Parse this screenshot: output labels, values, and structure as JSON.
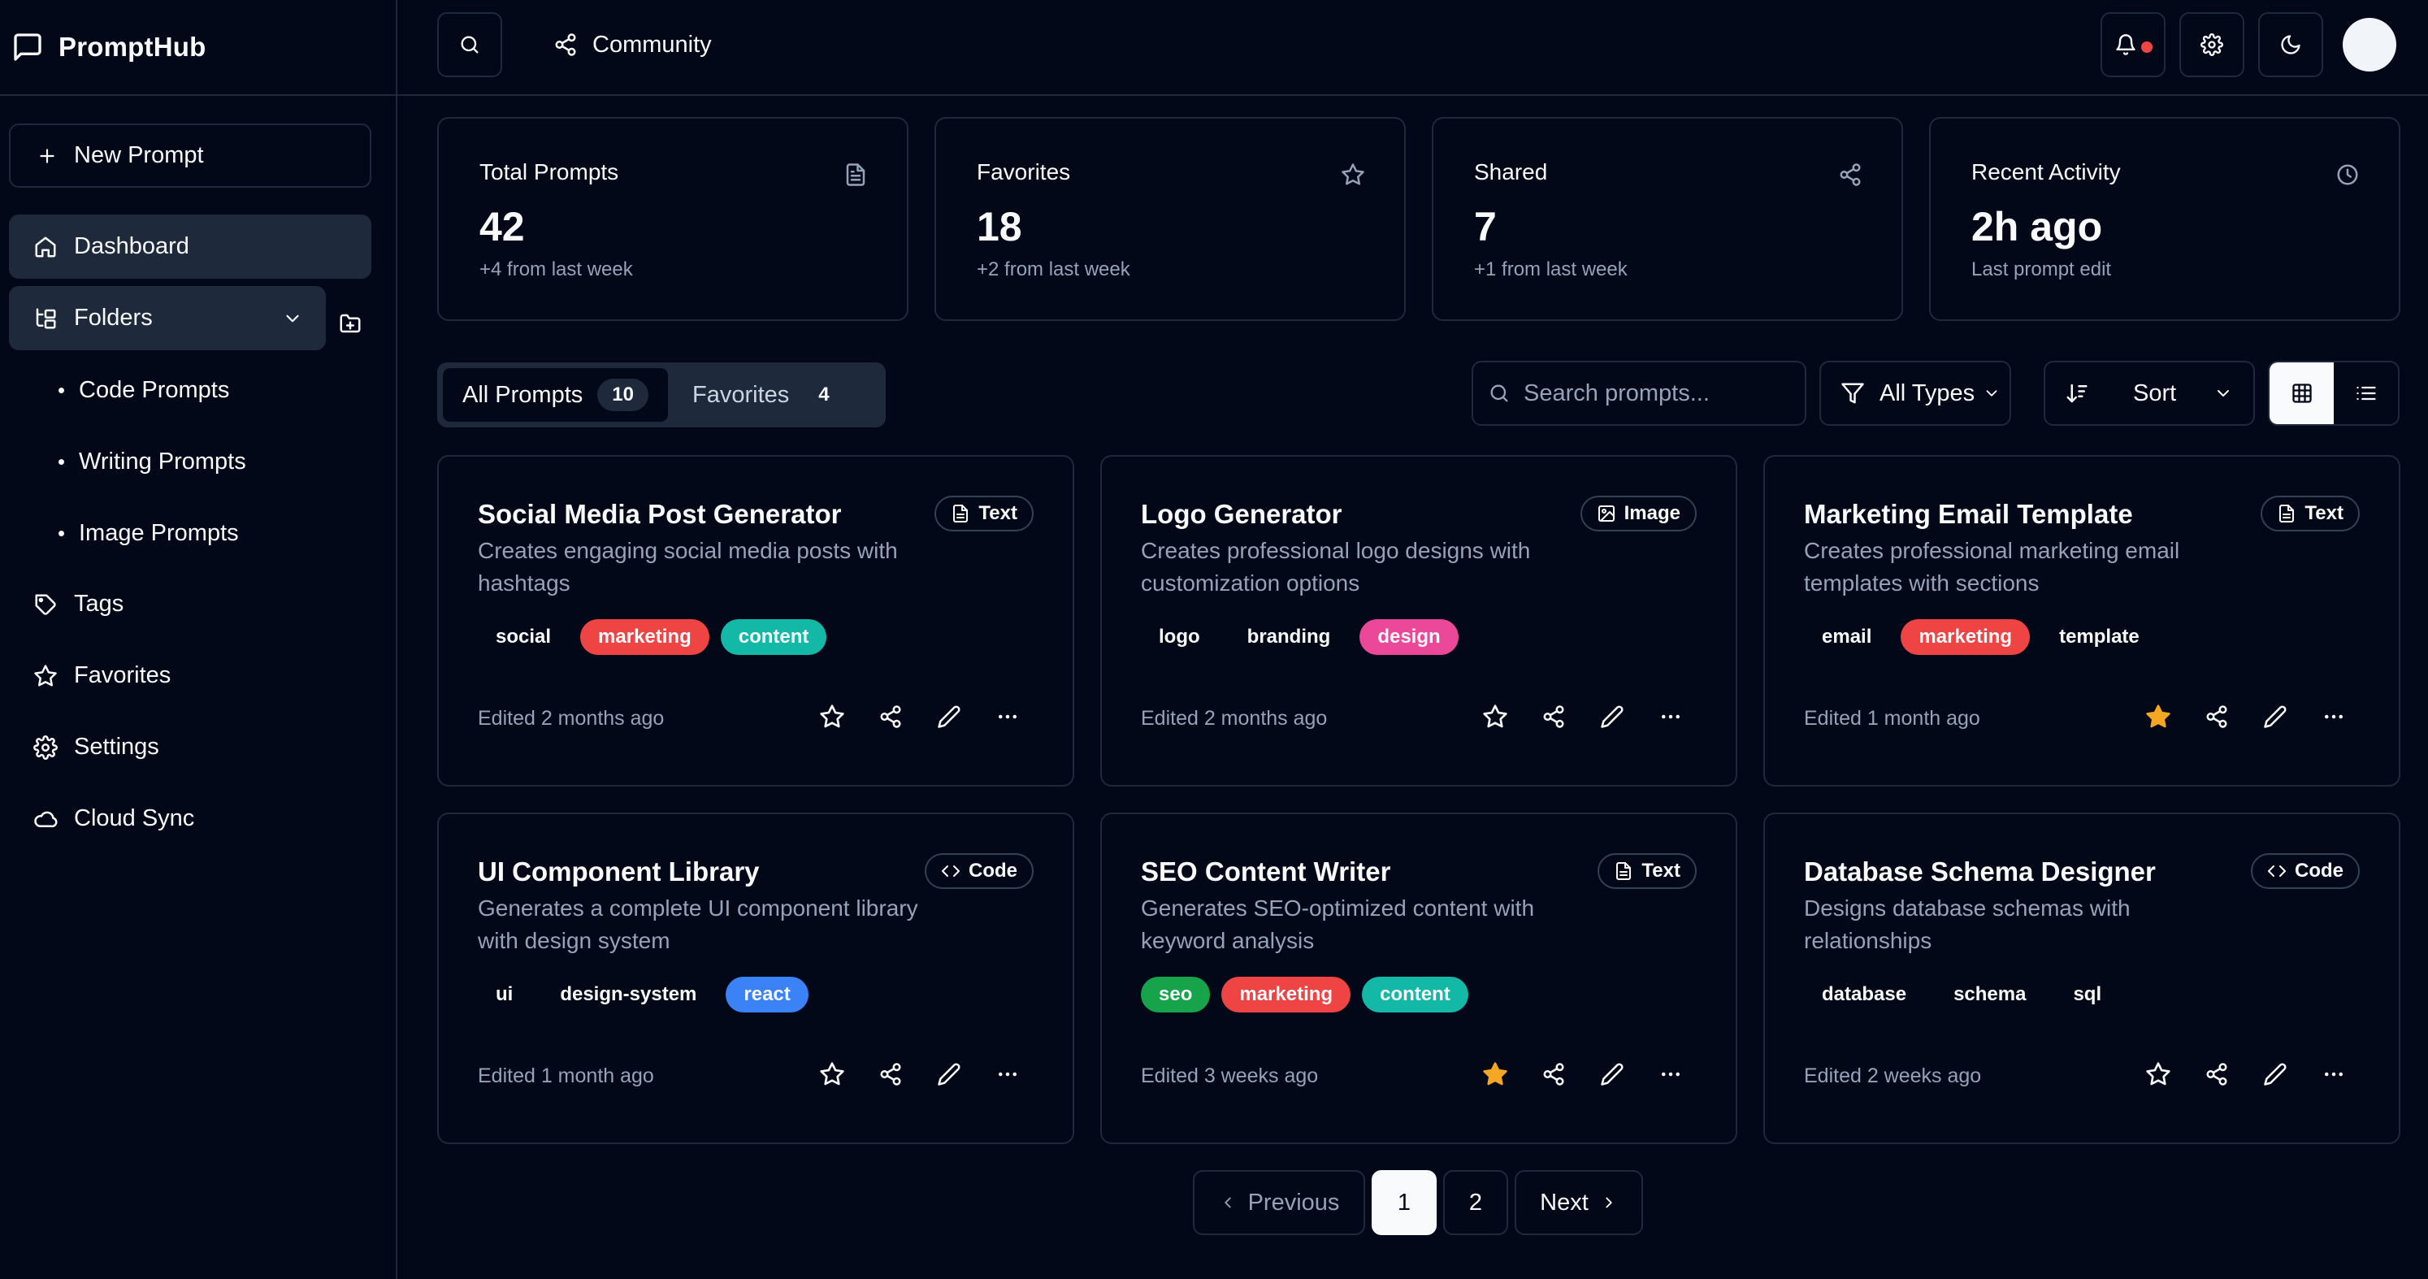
{
  "app": {
    "name": "PromptHub"
  },
  "sidebar": {
    "new_prompt": "New Prompt",
    "items": [
      {
        "label": "Dashboard"
      },
      {
        "label": "Folders"
      },
      {
        "label": "Tags"
      },
      {
        "label": "Favorites"
      },
      {
        "label": "Settings"
      },
      {
        "label": "Cloud Sync"
      }
    ],
    "folders": [
      {
        "label": "Code Prompts"
      },
      {
        "label": "Writing Prompts"
      },
      {
        "label": "Image Prompts"
      }
    ]
  },
  "topbar": {
    "community": "Community",
    "notification_dot_color": "#ef4444"
  },
  "stats": [
    {
      "label": "Total Prompts",
      "value": "42",
      "sub": "+4 from last week",
      "icon": "file-text-icon"
    },
    {
      "label": "Favorites",
      "value": "18",
      "sub": "+2 from last week",
      "icon": "star-icon"
    },
    {
      "label": "Shared",
      "value": "7",
      "sub": "+1 from last week",
      "icon": "share-icon"
    },
    {
      "label": "Recent Activity",
      "value": "2h ago",
      "sub": "Last prompt edit",
      "icon": "clock-icon"
    }
  ],
  "tabs": [
    {
      "label": "All Prompts",
      "count": "10"
    },
    {
      "label": "Favorites",
      "count": "4"
    }
  ],
  "search": {
    "placeholder": "Search prompts..."
  },
  "filters": {
    "type": "All Types",
    "sort": "Sort"
  },
  "cards": [
    {
      "title": "Social Media Post Generator",
      "description": "Creates engaging social media posts with hashtags",
      "type": "Text",
      "type_icon": "file-text-icon",
      "tags": [
        {
          "label": "social",
          "color": ""
        },
        {
          "label": "marketing",
          "color": "#ef4444"
        },
        {
          "label": "content",
          "color": "#14b8a6"
        }
      ],
      "edited": "Edited 2 months ago",
      "favorite": false
    },
    {
      "title": "Logo Generator",
      "description": "Creates professional logo designs with customization options",
      "type": "Image",
      "type_icon": "image-icon",
      "tags": [
        {
          "label": "logo",
          "color": ""
        },
        {
          "label": "branding",
          "color": ""
        },
        {
          "label": "design",
          "color": "#ec4899"
        }
      ],
      "edited": "Edited 2 months ago",
      "favorite": false
    },
    {
      "title": "Marketing Email Template",
      "description": "Creates professional marketing email templates with sections",
      "type": "Text",
      "type_icon": "file-text-icon",
      "tags": [
        {
          "label": "email",
          "color": ""
        },
        {
          "label": "marketing",
          "color": "#ef4444"
        },
        {
          "label": "template",
          "color": ""
        }
      ],
      "edited": "Edited 1 month ago",
      "favorite": true
    },
    {
      "title": "UI Component Library",
      "description": "Generates a complete UI component library with design system",
      "type": "Code",
      "type_icon": "code-icon",
      "tags": [
        {
          "label": "ui",
          "color": ""
        },
        {
          "label": "design-system",
          "color": ""
        },
        {
          "label": "react",
          "color": "#3b82f6"
        }
      ],
      "edited": "Edited 1 month ago",
      "favorite": false
    },
    {
      "title": "SEO Content Writer",
      "description": "Generates SEO-optimized content with keyword analysis",
      "type": "Text",
      "type_icon": "file-text-icon",
      "tags": [
        {
          "label": "seo",
          "color": "#16a34a"
        },
        {
          "label": "marketing",
          "color": "#ef4444"
        },
        {
          "label": "content",
          "color": "#14b8a6"
        }
      ],
      "edited": "Edited 3 weeks ago",
      "favorite": true
    },
    {
      "title": "Database Schema Designer",
      "description": "Designs database schemas with relationships",
      "type": "Code",
      "type_icon": "code-icon",
      "tags": [
        {
          "label": "database",
          "color": ""
        },
        {
          "label": "schema",
          "color": ""
        },
        {
          "label": "sql",
          "color": ""
        }
      ],
      "edited": "Edited 2 weeks ago",
      "favorite": false
    }
  ],
  "pagination": {
    "previous": "Previous",
    "pages": [
      "1",
      "2"
    ],
    "next": "Next",
    "current": "1"
  },
  "colors": {
    "background": "#020817",
    "border": "#1e293b",
    "muted_text": "#94a3b8",
    "favorite_star": "#f5a623"
  }
}
